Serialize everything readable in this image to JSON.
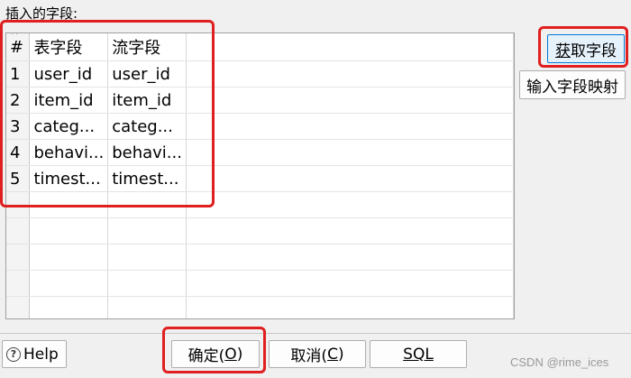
{
  "section_label": "插入的字段:",
  "grid": {
    "headers": {
      "rownum": "#",
      "table_field": "表字段",
      "stream_field": "流字段"
    },
    "rows": [
      {
        "num": "1",
        "table_field": "user_id",
        "stream_field": "user_id"
      },
      {
        "num": "2",
        "table_field": "item_id",
        "stream_field": "item_id"
      },
      {
        "num": "3",
        "table_field": "categ...",
        "stream_field": "categ..."
      },
      {
        "num": "4",
        "table_field": "behavi...",
        "stream_field": "behavi..."
      },
      {
        "num": "5",
        "table_field": "timest...",
        "stream_field": "timest..."
      }
    ]
  },
  "side_buttons": {
    "get_fields_prefix": "获",
    "get_fields_rest": "取字段",
    "map_fields": "输入字段映射"
  },
  "footer": {
    "help": "Help",
    "ok_text": "确定(",
    "ok_key": "O",
    "ok_end": ")",
    "cancel_text": "取消(",
    "cancel_key": "C",
    "cancel_end": ")",
    "sql": "SQL"
  },
  "watermark": "CSDN @rime_ices",
  "highlight_color": "#e02020"
}
